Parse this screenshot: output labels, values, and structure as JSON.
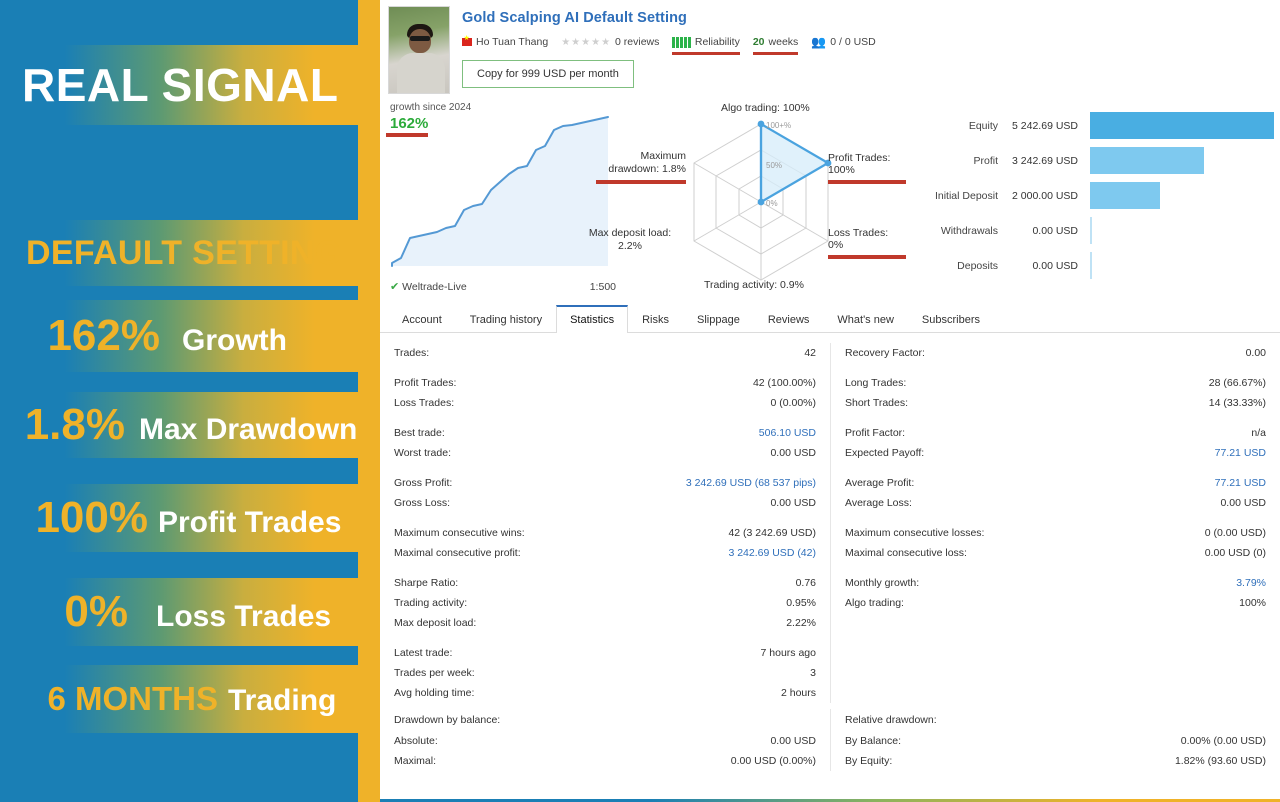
{
  "promo": {
    "title": "REAL SIGNAL",
    "subtitle": "DEFAULT SETTING",
    "stats": [
      {
        "value": "162%",
        "label": "Growth"
      },
      {
        "value": "1.8%",
        "label": "Max Drawdown"
      },
      {
        "value": "100%",
        "label": "Profit Trades"
      },
      {
        "value": "0%",
        "label": "Loss Trades"
      },
      {
        "value": "6 MONTHS",
        "label": "Trading"
      }
    ],
    "colors": {
      "blue": "#1a7fb5",
      "gold": "#efb229",
      "white": "#ffffff"
    }
  },
  "signal": {
    "name": "Gold Scalping AI Default Setting",
    "author": "Ho Tuan Thang",
    "flag_icon": "vietnam-flag-icon",
    "reviews": "0 reviews",
    "stars": "★★★★★",
    "reliability_label": "Reliability",
    "weeks_value": "20",
    "weeks_unit": "weeks",
    "subscribers": "0 / 0 USD",
    "subscribers_icon": "subscribers-icon",
    "copy_button": "Copy for 999 USD per month"
  },
  "growth": {
    "caption": "growth since 2024",
    "value": "162%",
    "broker": "Weltrade-Live",
    "broker_icon": "verified-shield-icon",
    "leverage": "1:500"
  },
  "radar": {
    "ring_labels": [
      "100+%",
      "50%",
      "0%"
    ],
    "axes": [
      {
        "name": "Algo trading",
        "text": "Algo trading: 100%",
        "value": 100,
        "underlined": false
      },
      {
        "name": "Profit Trades",
        "text": "Profit Trades: 100%",
        "value": 100,
        "underlined": true
      },
      {
        "name": "Loss Trades",
        "text": "Loss Trades: 0%",
        "value": 0,
        "underlined": true
      },
      {
        "name": "Trading activity",
        "text": "Trading activity: 0.9%",
        "value": 0.9,
        "underlined": false
      },
      {
        "name": "Max deposit load",
        "text": "Max deposit load:|2.2%",
        "value": 2.2,
        "underlined": false
      },
      {
        "name": "Maximum drawdown",
        "text": "Maximum|drawdown: 1.8%",
        "value": 1.8,
        "underlined": true
      }
    ]
  },
  "balance_bars": {
    "rows": [
      {
        "label": "Equity",
        "value": "5 242.69 USD",
        "pct": 100,
        "tone": "dark"
      },
      {
        "label": "Profit",
        "value": "3 242.69 USD",
        "pct": 61.8,
        "tone": "light"
      },
      {
        "label": "Initial Deposit",
        "value": "2 000.00 USD",
        "pct": 38.1,
        "tone": "light"
      },
      {
        "label": "Withdrawals",
        "value": "0.00 USD",
        "pct": 0,
        "tone": "nil"
      },
      {
        "label": "Deposits",
        "value": "0.00 USD",
        "pct": 0,
        "tone": "nil"
      }
    ]
  },
  "tabs": [
    {
      "label": "Account",
      "active": false
    },
    {
      "label": "Trading history",
      "active": false
    },
    {
      "label": "Statistics",
      "active": true
    },
    {
      "label": "Risks",
      "active": false
    },
    {
      "label": "Slippage",
      "active": false
    },
    {
      "label": "Reviews",
      "active": false
    },
    {
      "label": "What's new",
      "active": false
    },
    {
      "label": "Subscribers",
      "active": false
    }
  ],
  "statistics": {
    "left": [
      {
        "key": "Trades:",
        "value": "42",
        "tone": "plain"
      },
      {
        "gap": true
      },
      {
        "key": "Profit Trades:",
        "value": "42 (100.00%)",
        "tone": "plain"
      },
      {
        "key": "Loss Trades:",
        "value": "0 (0.00%)",
        "tone": "plain"
      },
      {
        "gap": true
      },
      {
        "key": "Best trade:",
        "value": "506.10 USD",
        "tone": "blue"
      },
      {
        "key": "Worst trade:",
        "value": "0.00 USD",
        "tone": "plain"
      },
      {
        "gap": true
      },
      {
        "key": "Gross Profit:",
        "value": "3 242.69 USD (68 537 pips)",
        "tone": "blue"
      },
      {
        "key": "Gross Loss:",
        "value": "0.00 USD",
        "tone": "plain"
      },
      {
        "gap": true
      },
      {
        "key": "Maximum consecutive wins:",
        "value": "42 (3 242.69 USD)",
        "tone": "plain"
      },
      {
        "key": "Maximal consecutive profit:",
        "value": "3 242.69 USD (42)",
        "tone": "blue"
      },
      {
        "gap": true
      },
      {
        "key": "Sharpe Ratio:",
        "value": "0.76",
        "tone": "plain"
      },
      {
        "key": "Trading activity:",
        "value": "0.95%",
        "tone": "plain"
      },
      {
        "key": "Max deposit load:",
        "value": "2.22%",
        "tone": "plain"
      },
      {
        "gap": true
      },
      {
        "key": "Latest trade:",
        "value": "7 hours ago",
        "tone": "plain"
      },
      {
        "key": "Trades per week:",
        "value": "3",
        "tone": "plain"
      },
      {
        "key": "Avg holding time:",
        "value": "2 hours",
        "tone": "plain"
      }
    ],
    "right": [
      {
        "key": "Recovery Factor:",
        "value": "0.00",
        "tone": "plain"
      },
      {
        "gap": true
      },
      {
        "key": "Long Trades:",
        "value": "28 (66.67%)",
        "tone": "plain"
      },
      {
        "key": "Short Trades:",
        "value": "14 (33.33%)",
        "tone": "plain"
      },
      {
        "gap": true
      },
      {
        "key": "Profit Factor:",
        "value": "n/a",
        "tone": "plain"
      },
      {
        "key": "Expected Payoff:",
        "value": "77.21 USD",
        "tone": "blue"
      },
      {
        "gap": true
      },
      {
        "key": "Average Profit:",
        "value": "77.21 USD",
        "tone": "blue"
      },
      {
        "key": "Average Loss:",
        "value": "0.00 USD",
        "tone": "plain"
      },
      {
        "gap": true
      },
      {
        "key": "Maximum consecutive losses:",
        "value": "0 (0.00 USD)",
        "tone": "plain"
      },
      {
        "key": "Maximal consecutive loss:",
        "value": "0.00 USD (0)",
        "tone": "plain"
      },
      {
        "gap": true
      },
      {
        "key": "Monthly growth:",
        "value": "3.79%",
        "tone": "blue"
      },
      {
        "key": "Algo trading:",
        "value": "100%",
        "tone": "plain"
      }
    ]
  },
  "drawdown": {
    "left_title": "Drawdown by balance:",
    "left_rows": [
      {
        "key": "Absolute:",
        "value": "0.00 USD",
        "tone": "plain"
      },
      {
        "key": "Maximal:",
        "value": "0.00 USD (0.00%)",
        "tone": "plain"
      }
    ],
    "right_title": "Relative drawdown:",
    "right_rows": [
      {
        "key": "By Balance:",
        "value": "0.00% (0.00 USD)",
        "tone": "plain"
      },
      {
        "key": "By Equity:",
        "value": "1.82% (93.60 USD)",
        "tone": "mixed",
        "red_part": "93.60"
      }
    ]
  },
  "chart_data": [
    {
      "type": "line",
      "title": "growth since 2024",
      "ylabel": "",
      "xlabel": "",
      "annotation": "162%",
      "x": [
        0,
        4,
        8,
        12,
        16,
        20,
        24,
        28,
        32,
        36,
        40,
        44,
        48,
        52,
        56,
        60,
        64,
        68,
        72,
        76,
        80,
        84,
        88,
        92,
        96,
        100
      ],
      "y": [
        2,
        5,
        9,
        22,
        26,
        27,
        28,
        30,
        31,
        38,
        40,
        41,
        48,
        52,
        56,
        60,
        61,
        70,
        74,
        86,
        90,
        91,
        92,
        94,
        96,
        99
      ],
      "ylim": [
        0,
        100
      ],
      "grid": false
    },
    {
      "type": "radar",
      "title": "",
      "categories": [
        "Algo trading",
        "Profit Trades",
        "Loss Trades",
        "Trading activity",
        "Max deposit load",
        "Maximum drawdown"
      ],
      "values": [
        100,
        100,
        0,
        0.9,
        2.2,
        1.8
      ],
      "ylim": [
        0,
        100
      ],
      "tick_labels": [
        "0%",
        "50%",
        "100+%"
      ]
    },
    {
      "type": "bar",
      "title": "",
      "orientation": "horizontal",
      "categories": [
        "Equity",
        "Profit",
        "Initial Deposit",
        "Withdrawals",
        "Deposits"
      ],
      "values": [
        5242.69,
        3242.69,
        2000.0,
        0.0,
        0.0
      ],
      "value_labels": [
        "5 242.69 USD",
        "3 242.69 USD",
        "2 000.00 USD",
        "0.00 USD",
        "0.00 USD"
      ],
      "xlim": [
        0,
        5242.69
      ],
      "grid": false
    }
  ]
}
